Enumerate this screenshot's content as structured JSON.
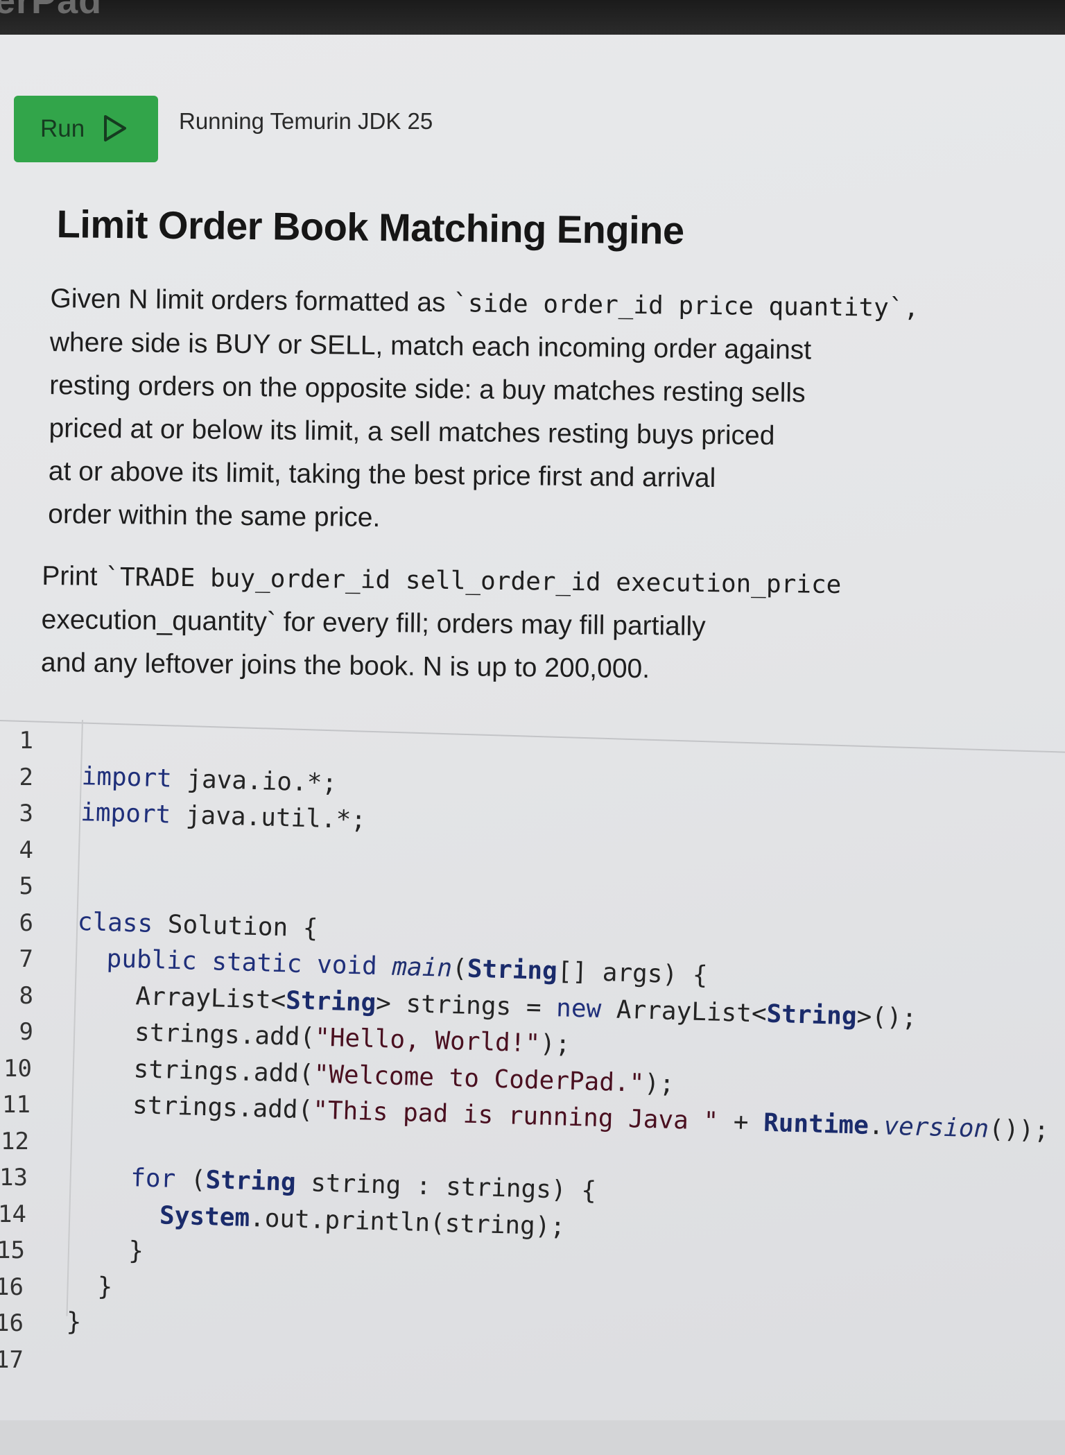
{
  "top_bar": {
    "logo_text": "erPad"
  },
  "toolbar": {
    "run_label": "Run",
    "status": "Running Temurin JDK 25"
  },
  "problem": {
    "title": "Limit Order Book Matching Engine",
    "paragraph1": {
      "line1_prefix": "Given N limit orders formatted as ",
      "line1_code": "`side order_id price quantity`,",
      "rest": "where side is BUY or SELL, match each incoming order against\nresting orders on the opposite side: a buy matches resting sells\npriced at or below its limit, a sell matches resting buys priced\nat or above its limit, taking the best price first and arrival\norder within the same price."
    },
    "paragraph2": {
      "prefix": "Print ",
      "code": "`TRADE buy_order_id sell_order_id execution_price",
      "line2": "execution_quantity` for every fill; orders may fill partially",
      "line3": "and any leftover joins the book. N is up to 200,000."
    }
  },
  "editor": {
    "line_numbers": [
      "1",
      "2",
      "3",
      "4",
      "5",
      "6",
      "7",
      "8",
      "9",
      "10",
      "11",
      "12",
      "13",
      "14",
      "15",
      "16",
      "16",
      "17"
    ],
    "code_lines": [
      "",
      "import java.io.*;",
      "import java.util.*;",
      "",
      "",
      "class Solution {",
      "  public static void main(String[] args) {",
      "    ArrayList<String> strings = new ArrayList<String>();",
      "    strings.add(\"Hello, World!\");",
      "    strings.add(\"Welcome to CoderPad.\");",
      "    strings.add(\"This pad is running Java \" + Runtime.version());",
      "",
      "    for (String string : strings) {",
      "      System.out.println(string);",
      "    }",
      "  }",
      "}",
      ""
    ]
  }
}
